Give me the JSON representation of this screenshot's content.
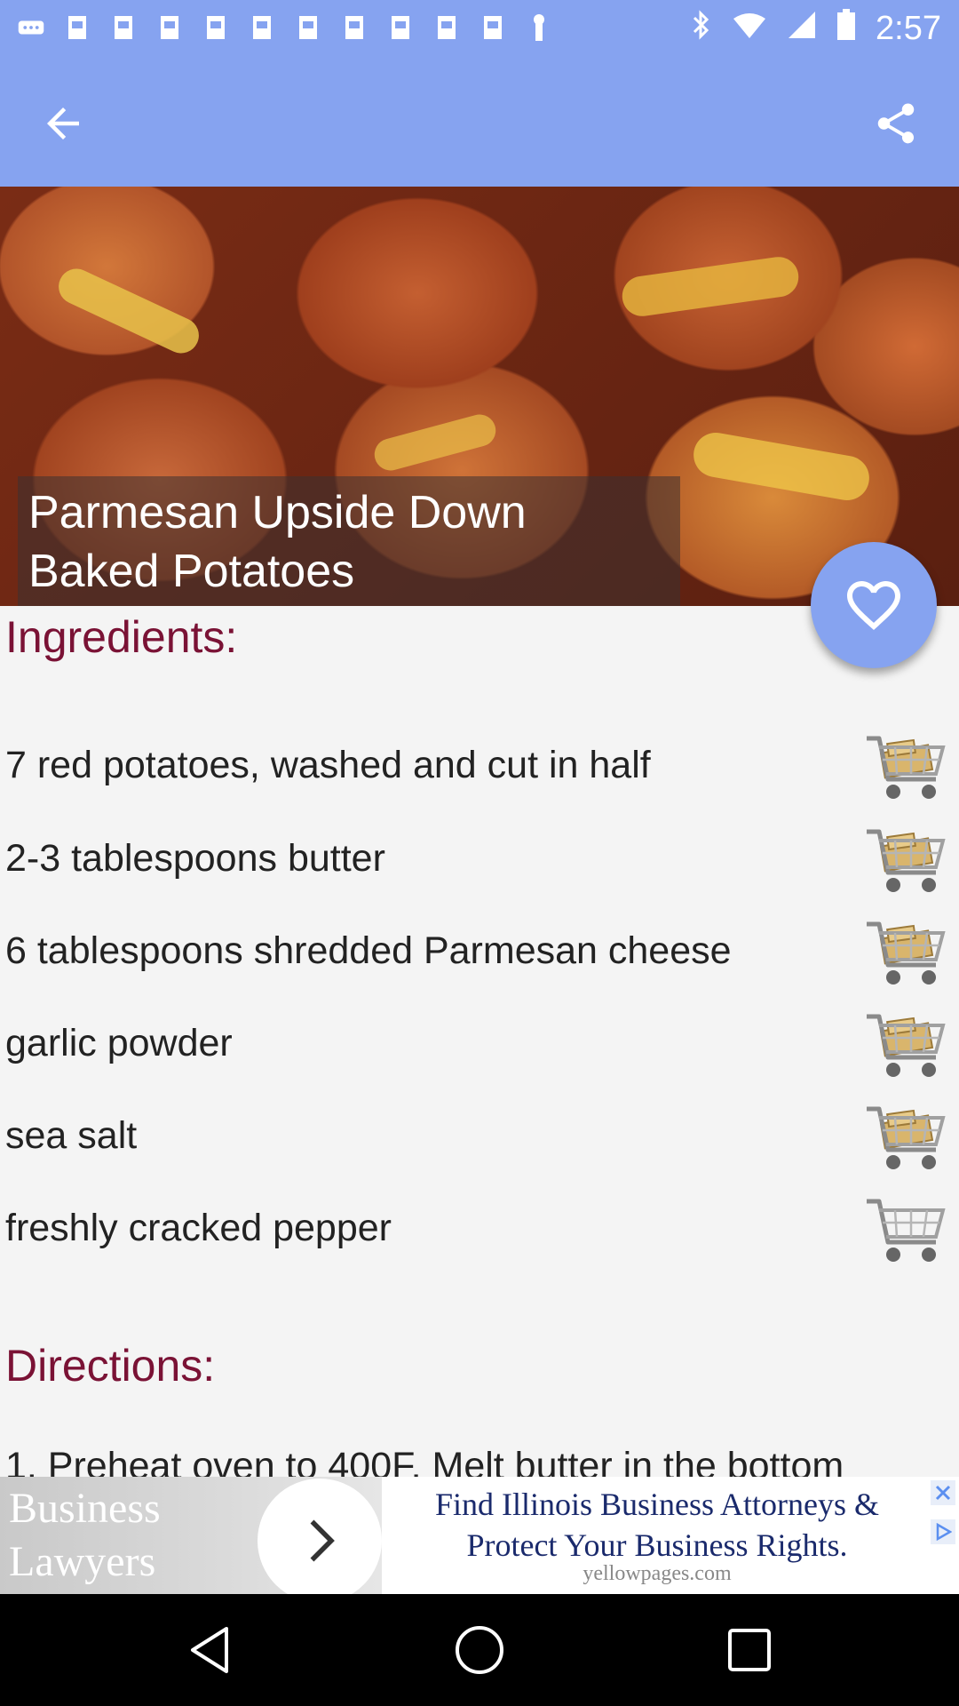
{
  "status_bar": {
    "time": "2:57",
    "icons": [
      "more-icon",
      "image-icon",
      "image-icon",
      "image-icon",
      "image-icon",
      "image-icon",
      "image-icon",
      "image-icon",
      "image-icon",
      "image-icon",
      "image-icon",
      "upload-icon"
    ],
    "right_icons": [
      "bluetooth-icon",
      "wifi-icon",
      "signal-icon",
      "battery-icon"
    ]
  },
  "app_bar": {
    "back_icon": "arrow-back-icon",
    "share_icon": "share-icon"
  },
  "recipe": {
    "title_line1": "Parmesan Upside Down",
    "title_line2": "Baked Potatoes"
  },
  "ingredients": {
    "heading": "Ingredients:",
    "items": [
      {
        "text": "7 red potatoes, washed and cut in half",
        "in_cart": true
      },
      {
        "text": "2-3 tablespoons butter",
        "in_cart": true
      },
      {
        "text": "6 tablespoons shredded Parmesan cheese",
        "in_cart": true
      },
      {
        "text": "garlic powder",
        "in_cart": true
      },
      {
        "text": "sea salt",
        "in_cart": true
      },
      {
        "text": "freshly cracked pepper",
        "in_cart": false
      }
    ]
  },
  "directions": {
    "heading": "Directions:",
    "first_step": "1. Preheat oven to 400F. Melt butter in the bottom"
  },
  "ad": {
    "left_line1": "Business",
    "left_line2": "Lawyers",
    "headline": "Find Illinois Business Attorneys & Protect Your Business Rights.",
    "domain": "yellowpages.com"
  },
  "colors": {
    "accent": "#86a3f0",
    "heading": "#7a1235"
  }
}
